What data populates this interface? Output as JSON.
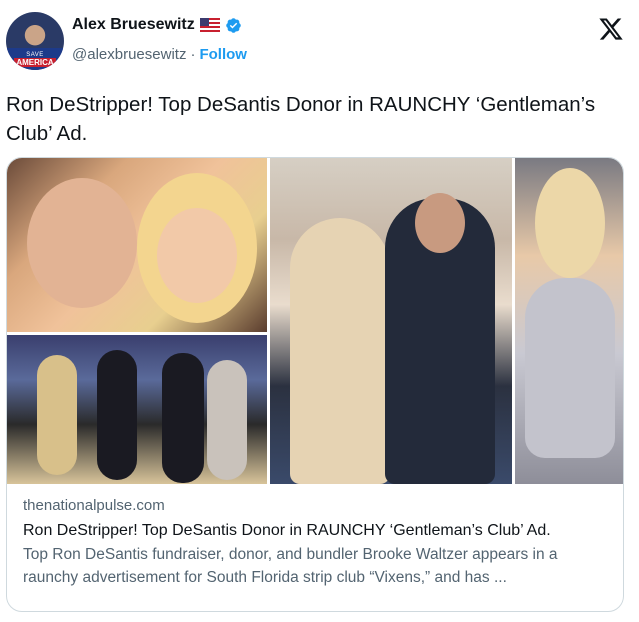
{
  "author": {
    "display_name": "Alex Bruesewitz",
    "handle": "@alexbruesewitz",
    "separator": "·",
    "follow_label": "Follow",
    "avatar_text_line1": "SAVE",
    "avatar_text_line2": "AMERICA"
  },
  "tweet": {
    "text": "Ron DeStripper! Top DeSantis Donor in RAUNCHY ‘Gentleman’s Club’ Ad."
  },
  "card": {
    "domain": "thenationalpulse.com",
    "headline": "Ron DeStripper! Top DeSantis Donor in RAUNCHY ‘Gentleman’s Club’ Ad.",
    "description": "Top Ron DeSantis fundraiser, donor, and bundler Brooke Waltzer appears in a raunchy advertisement for South Florida strip club “Vixens,” and has ..."
  },
  "icons": {
    "flag": "us-flag-icon",
    "verified": "verified-badge-icon",
    "platform": "x-logo-icon"
  },
  "colors": {
    "link_blue": "#1d9bf0",
    "secondary_text": "#536471",
    "primary_text": "#0f1419",
    "border": "#cfd9de"
  }
}
